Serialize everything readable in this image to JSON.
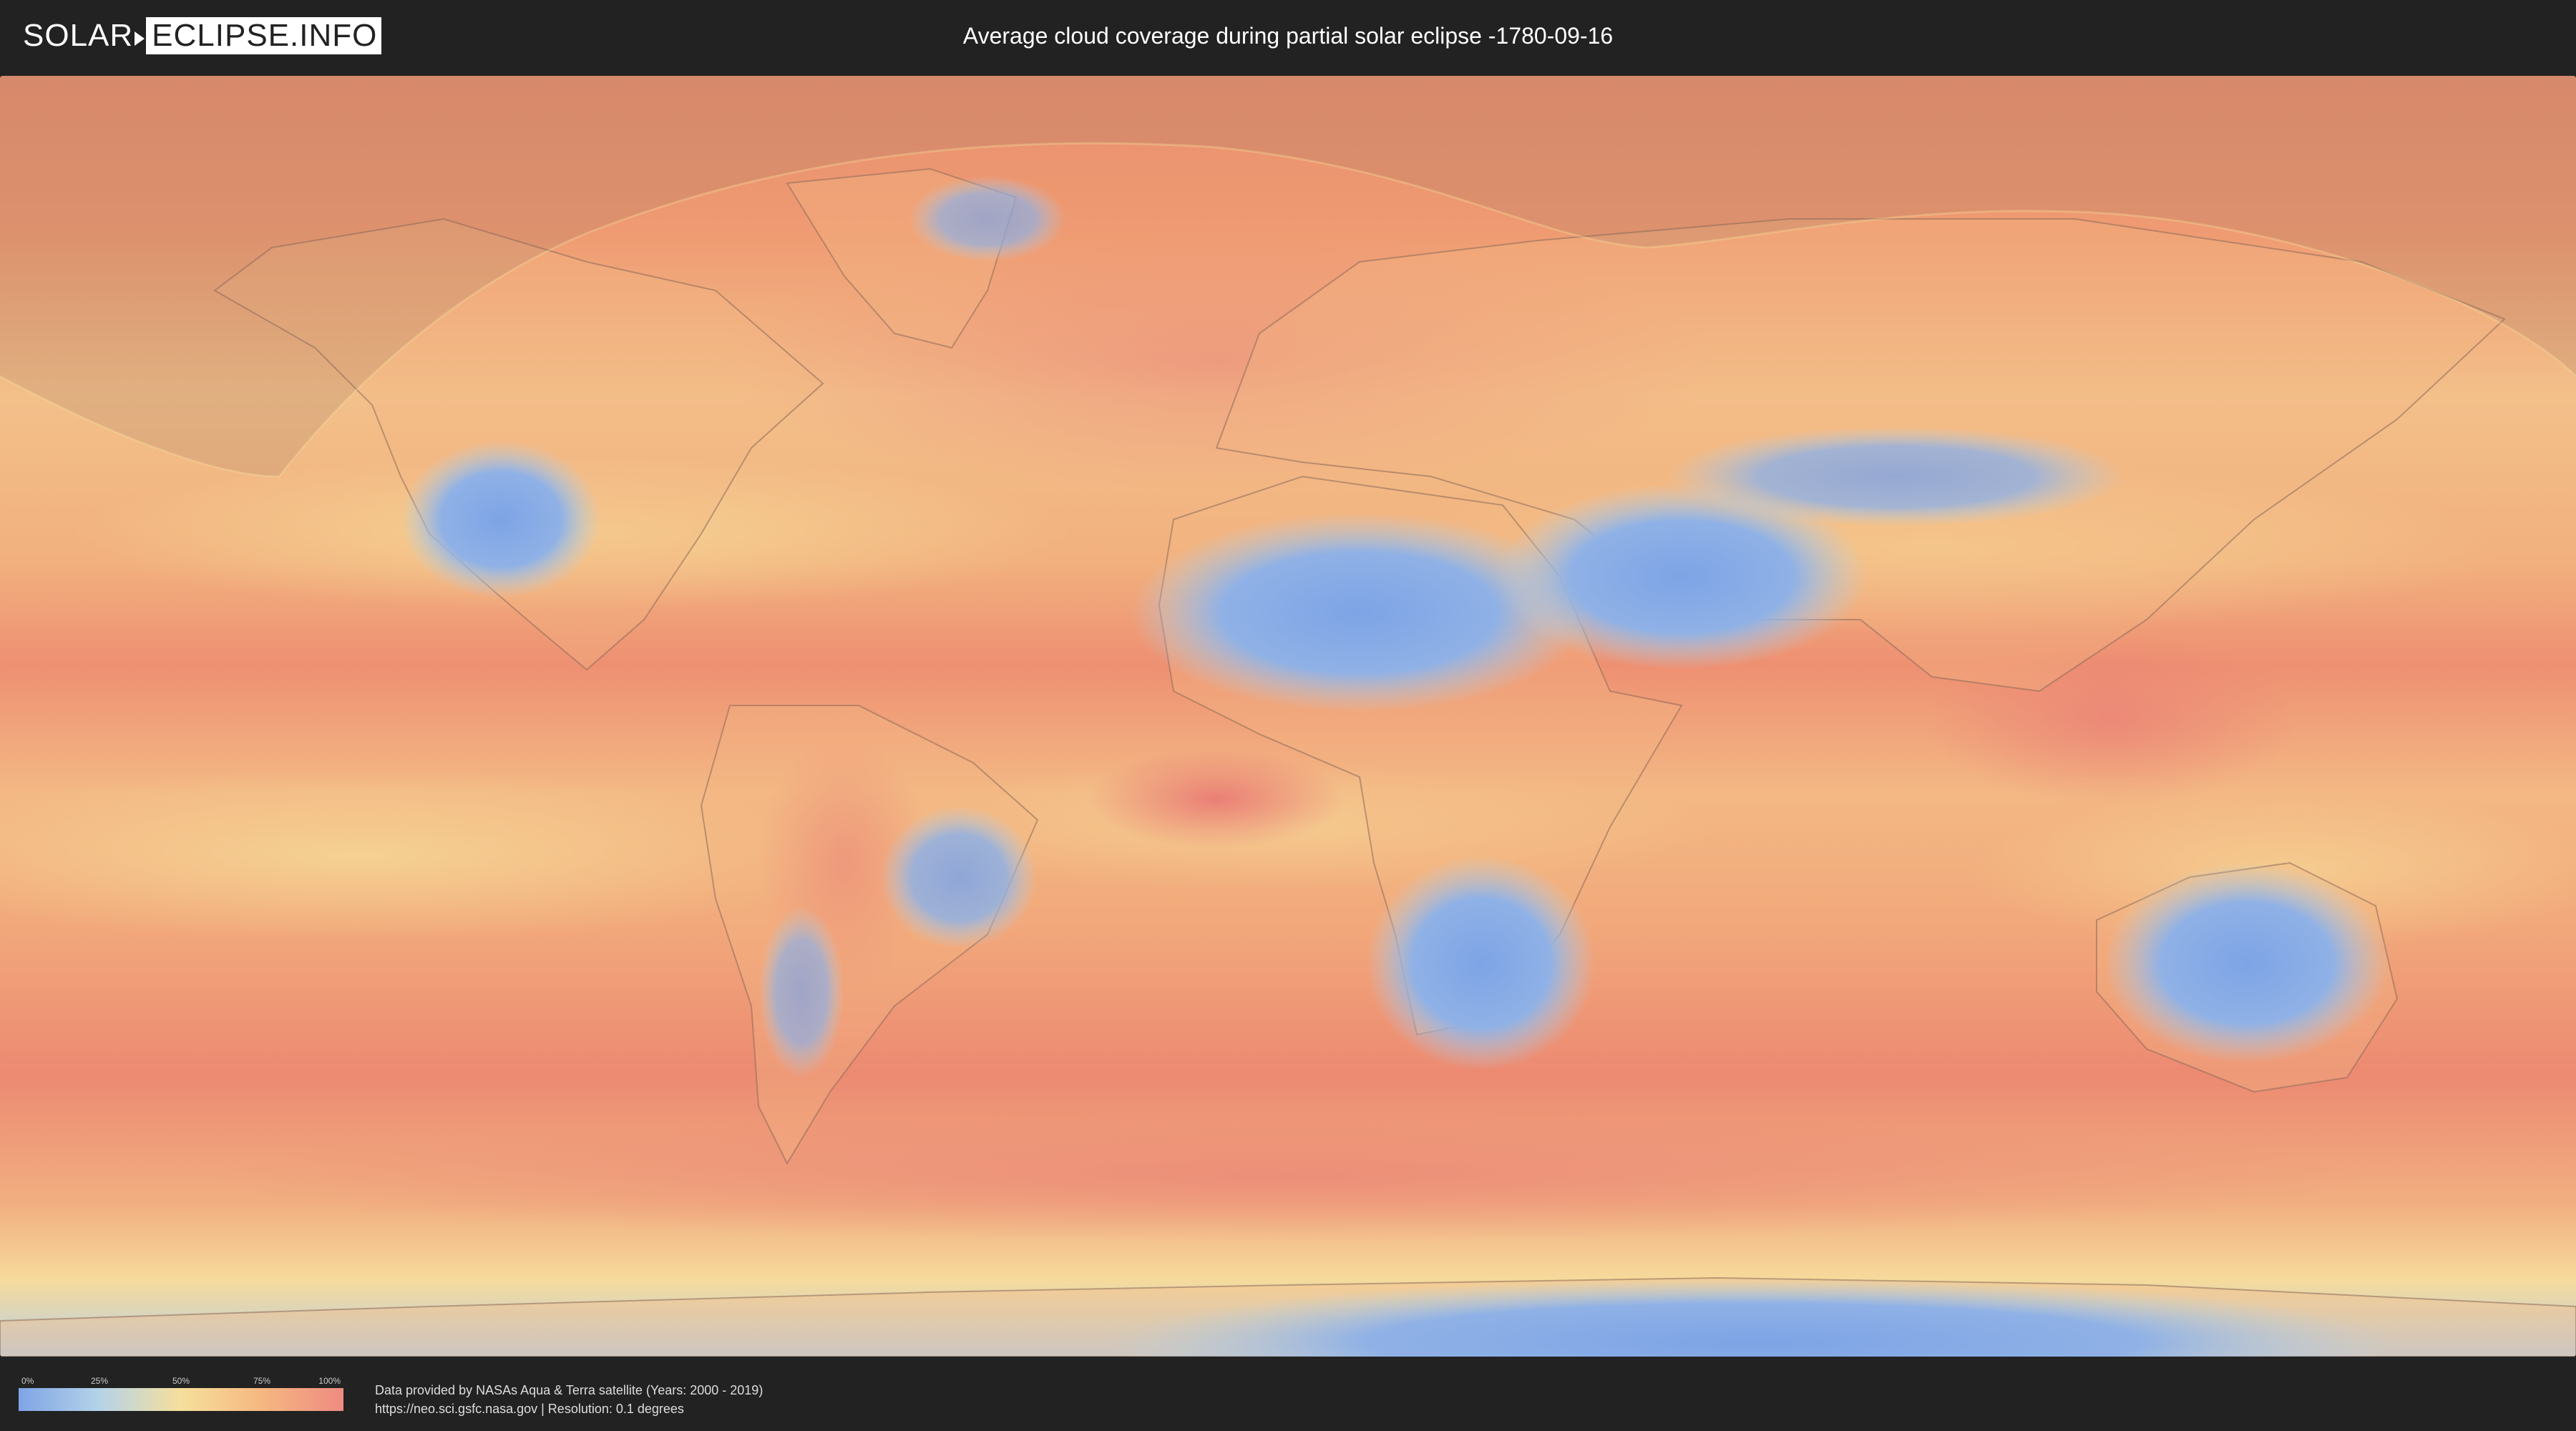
{
  "header": {
    "logo_left": "SOLAR",
    "logo_right": "ECLIPSE.INFO",
    "title": "Average cloud coverage during partial solar eclipse -1780-09-16"
  },
  "legend": {
    "ticks": [
      "0%",
      "25%",
      "50%",
      "75%",
      "100%"
    ],
    "colors": [
      "#7ea4e6",
      "#b5d3e8",
      "#f6df9b",
      "#f5b781",
      "#ee8b80"
    ]
  },
  "credits": {
    "line1": "Data provided by NASAs Aqua & Terra satellite (Years: 2000 - 2019)",
    "line2": "https://neo.sci.gsfc.nasa.gov | Resolution: 0.1 degrees"
  },
  "map": {
    "projection": "equirectangular",
    "layer": "average cloud coverage",
    "overlay": "partial eclipse visibility shading over northern high latitudes",
    "colors": {
      "clear": "#7ea4e6",
      "low": "#b5d3e8",
      "mid": "#f6df9b",
      "high": "#f5b781",
      "overcast": "#ee8b80",
      "eclipse_shade": "#9a7a6a"
    }
  }
}
